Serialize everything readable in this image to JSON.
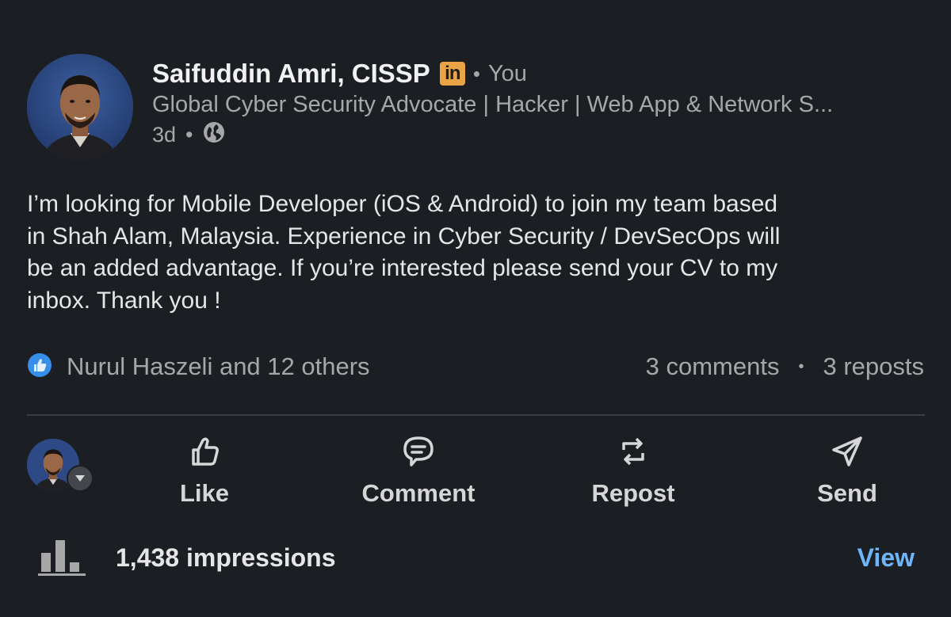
{
  "author": {
    "name": "Saifuddin Amri, CISSP",
    "badge": "in",
    "relation": "You",
    "headline": "Global Cyber Security Advocate | Hacker | Web App & Network S...",
    "time": "3d",
    "visibility_icon": "globe-icon"
  },
  "post": {
    "text": "I’m looking for Mobile Developer (iOS & Android) to join my team based\nin Shah Alam, Malaysia. Experience in Cyber Security / DevSecOps will\nbe an added advantage. If you’re interested please send your CV to my\ninbox. Thank you !"
  },
  "social": {
    "reaction_icon": "like-reaction-icon",
    "reactions": "Nurul Haszeli and 12 others",
    "comments": "3 comments",
    "reposts": "3 reposts"
  },
  "actions": {
    "like": "Like",
    "comment": "Comment",
    "repost": "Repost",
    "send": "Send"
  },
  "footer": {
    "impressions": "1,438 impressions",
    "view": "View"
  },
  "colors": {
    "background": "#1b1f23",
    "link": "#70b5f9",
    "linkedin_badge": "#e8a445",
    "reaction_blue": "#378fe9"
  }
}
